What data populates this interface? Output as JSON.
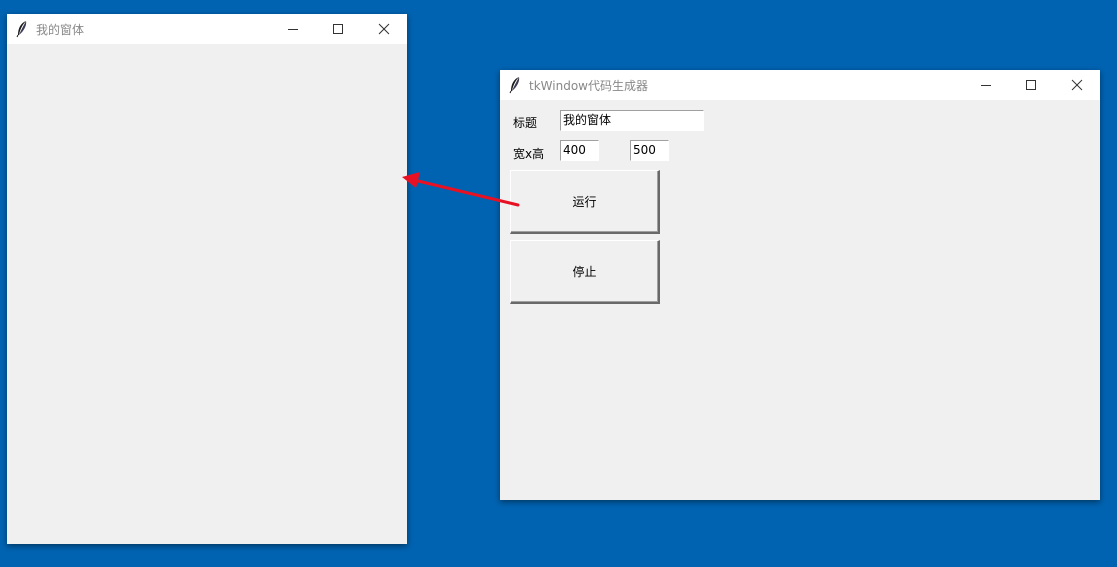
{
  "windows": {
    "child": {
      "title": "我的窗体"
    },
    "generator": {
      "title": "tkWindow代码生成器",
      "title_label": "标题",
      "title_value": "我的窗体",
      "size_label": "宽x高",
      "width_value": "400",
      "height_value": "500",
      "run_label": "运行",
      "stop_label": "停止"
    }
  },
  "icons": {
    "app": "feather-icon",
    "minimize": "minimize-icon",
    "maximize": "maximize-icon",
    "close": "close-icon"
  },
  "colors": {
    "desktop": "#0063b1",
    "window_body": "#f0f0f0",
    "titlebar": "#ffffff",
    "title_text": "#888888",
    "arrow": "#e81123"
  }
}
